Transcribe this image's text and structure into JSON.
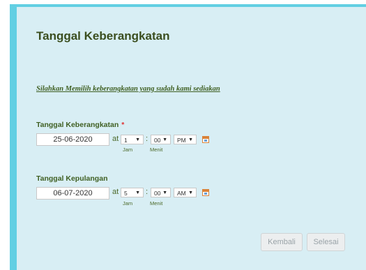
{
  "form": {
    "title": "Tanggal Keberangkatan",
    "subtitle": "Silahkan Memilih keberangkatan yang sudah kami sediakan"
  },
  "departure": {
    "label": "Tanggal Keberangkatan",
    "required_mark": "*",
    "date": "25-06-2020",
    "at": "at",
    "hour": "1",
    "minute": "00",
    "ampm": "PM",
    "hour_caption": "Jam",
    "minute_caption": "Menit"
  },
  "return": {
    "label": "Tanggal Kepulangan",
    "date": "06-07-2020",
    "at": "at",
    "hour": "5",
    "minute": "00",
    "ampm": "AM",
    "hour_caption": "Jam",
    "minute_caption": "Menit"
  },
  "separator": ":",
  "dropdown_arrow": "▼",
  "buttons": {
    "back": "Kembali",
    "finish": "Selesai"
  },
  "icons": {
    "calendar": "calendar-icon"
  }
}
